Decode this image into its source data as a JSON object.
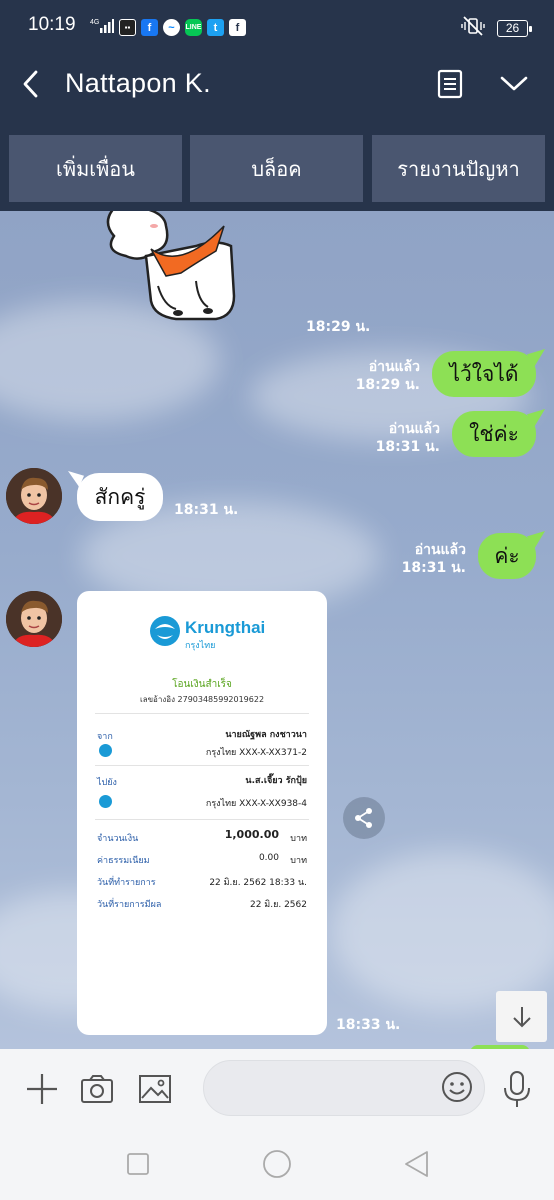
{
  "status_bar": {
    "time": "10:19",
    "network": "4G",
    "battery": "26",
    "app_icons": [
      "media-app-icon",
      "facebook-icon",
      "messenger-icon",
      "line-icon",
      "twitter-icon",
      "facebook-icon"
    ]
  },
  "header": {
    "contact_name": "Nattapon K."
  },
  "actions": {
    "add_friend": "เพิ่มเพื่อน",
    "block": "บล็อค",
    "report": "รายงานปัญหา"
  },
  "messages": [
    {
      "sender": "them",
      "type": "sticker",
      "time": "18:29 น."
    },
    {
      "sender": "me",
      "type": "text",
      "text": "ไว้ใจได้",
      "read": "อ่านแล้ว",
      "time": "18:29 น."
    },
    {
      "sender": "me",
      "type": "text",
      "text": "ใช่ค่ะ",
      "read": "อ่านแล้ว",
      "time": "18:31 น."
    },
    {
      "sender": "them",
      "type": "text",
      "text": "สักครู่",
      "time": "18:31 น."
    },
    {
      "sender": "me",
      "type": "text",
      "text": "ค่ะ",
      "read": "อ่านแล้ว",
      "time": "18:31 น."
    },
    {
      "sender": "them",
      "type": "image",
      "time": "18:33 น."
    }
  ],
  "slip": {
    "brand": "Krungthai",
    "brand_th": "กรุงไทย",
    "status": "โอนเงินสำเร็จ",
    "ref": "เลขอ้างอิง 2790348599201962​2",
    "from_label": "จาก",
    "from_name": "นายณัฐพล กงชาวนา",
    "from_account": "กรุงไทย XXX-X-XX371-2",
    "to_label": "ไปยัง",
    "to_name": "น.ส.เจี๊ยว รักปุ้ย",
    "to_account": "กรุงไทย XXX-X-XX938-4",
    "amount_label": "จำนวนเงิน",
    "amount": "1,000.00",
    "currency": "บาท",
    "fee_label": "ค่าธรรมเนียม",
    "fee": "0.00",
    "date_label": "วันที่ทำรายการ",
    "date": "22 มิ.ย. 2562 18:33 น.",
    "effective_label": "วันที่รายการมีผล",
    "effective_date": "22 มิ.ย. 2562"
  },
  "input": {
    "placeholder": ""
  },
  "colors": {
    "header_bg": "#27344b",
    "action_btn_bg": "#4a5670",
    "bubble_out": "#8de055",
    "bubble_in": "#ffffff",
    "krungthai_blue": "#1a9ad6"
  }
}
